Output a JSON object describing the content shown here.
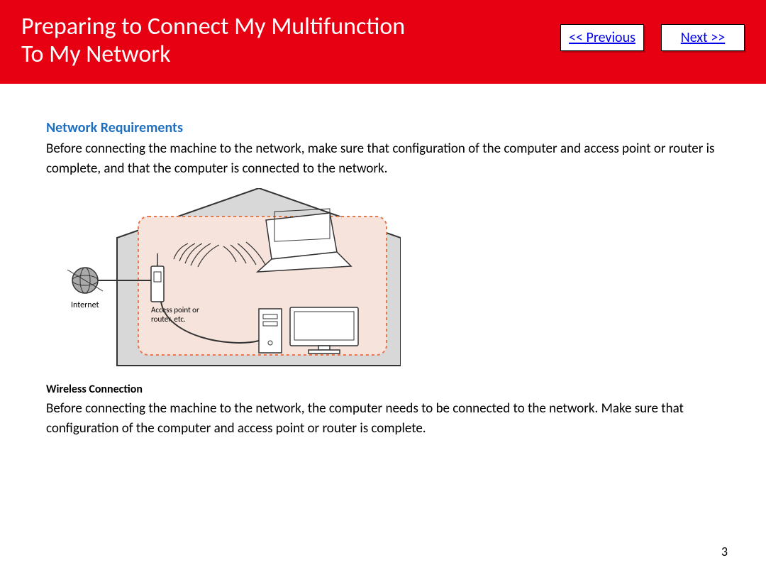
{
  "header": {
    "title_line1": "Preparing to Connect My Multifunction",
    "title_line2": "To My Network",
    "prev_label": "<< Previous",
    "next_label": "Next >>"
  },
  "content": {
    "section_heading": "Network Requirements",
    "intro": "Before connecting the machine to the network, make sure that configuration of the computer and access point or router is complete, and that the computer is connected to the network.",
    "sub_heading": "Wireless Connection",
    "sub_text": "Before connecting the machine to the network, the computer needs to be connected to the network. Make sure that configuration of the computer and access point or router is complete."
  },
  "diagram": {
    "internet_label": "Internet",
    "router_label": "Access point or\nrouter, etc."
  },
  "page_number": "3"
}
